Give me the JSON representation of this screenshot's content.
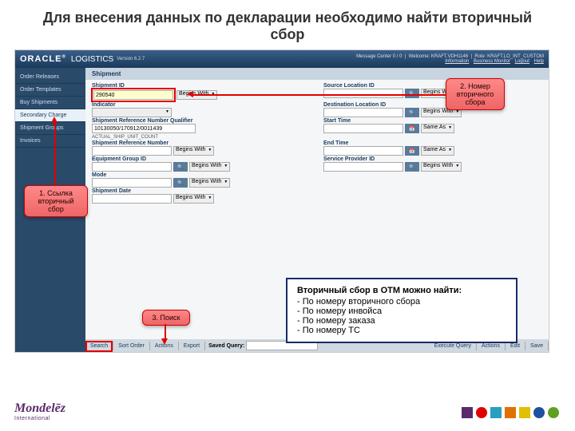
{
  "slide": {
    "title": "Для внесения данных по декларации необходимо найти вторичный сбор"
  },
  "header": {
    "brand": "ORACLE",
    "product": "LOGISTICS",
    "version": "Version 6.2.7",
    "msg_center": "Message Center  0 / 0",
    "welcome_label": "Welcome:",
    "welcome_user": "KRAFT.VDH1146",
    "role_label": "Role:",
    "role_value": "KRAFT.LO_INT_CUSTOM",
    "links": {
      "info": "Information",
      "bm": "Business Monitor",
      "logout": "Logout",
      "help": "Help"
    }
  },
  "sidebar": {
    "items": [
      {
        "label": "Order Releases"
      },
      {
        "label": "Order Templates"
      },
      {
        "label": "Buy Shipments"
      },
      {
        "label": "Secondary Charge"
      },
      {
        "label": "Shipment Groups"
      },
      {
        "label": "Invoices"
      }
    ]
  },
  "section": {
    "title": "Shipment"
  },
  "form": {
    "shipment_id": {
      "label": "Shipment ID",
      "value": "290540",
      "op": "Begins With"
    },
    "source_loc": {
      "label": "Source Location ID",
      "op": "Begins With"
    },
    "indicator": {
      "label": "Indicator"
    },
    "dest_loc": {
      "label": "Destination Location ID",
      "op": "Begins With"
    },
    "ref_qual": {
      "label": "Shipment Reference Number Qualifier",
      "value": "10130050/170912/0011439",
      "value2": "ACTUAL_SHIP_UNIT_COUNT"
    },
    "start_time": {
      "label": "Start Time",
      "op": "Same As"
    },
    "ref_num": {
      "label": "Shipment Reference Number",
      "op": "Begins With"
    },
    "end_time": {
      "label": "End Time",
      "op": "Same As"
    },
    "equip": {
      "label": "Equipment Group ID",
      "op": "Begins With"
    },
    "service_prov": {
      "label": "Service Provider ID",
      "op": "Begins With"
    },
    "mode": {
      "label": "Mode",
      "op": "Begins With"
    },
    "ship_date": {
      "label": "Shipment Date",
      "op": "Begins With"
    }
  },
  "bottom_bar": {
    "search": "Search",
    "sort": "Sort Order",
    "actions": "Actions",
    "export": "Export",
    "saved_query": "Saved Query:",
    "exec": "Execute Query",
    "actions2": "Actions",
    "edit": "Edit",
    "save": "Save"
  },
  "callouts": {
    "c1": "1. Ссылка\nвторичный сбор",
    "c2": "2. Номер\nвторичного\nсбора",
    "c3": "3. Поиск"
  },
  "info": {
    "title": "Вторичный сбор в OTM можно найти:",
    "items": [
      "По номеру вторичного сбора",
      "По номеру инвойса",
      "По номеру заказа",
      "По номеру ТС"
    ]
  },
  "brand": {
    "name": "Mondelēz",
    "sub": "International"
  }
}
